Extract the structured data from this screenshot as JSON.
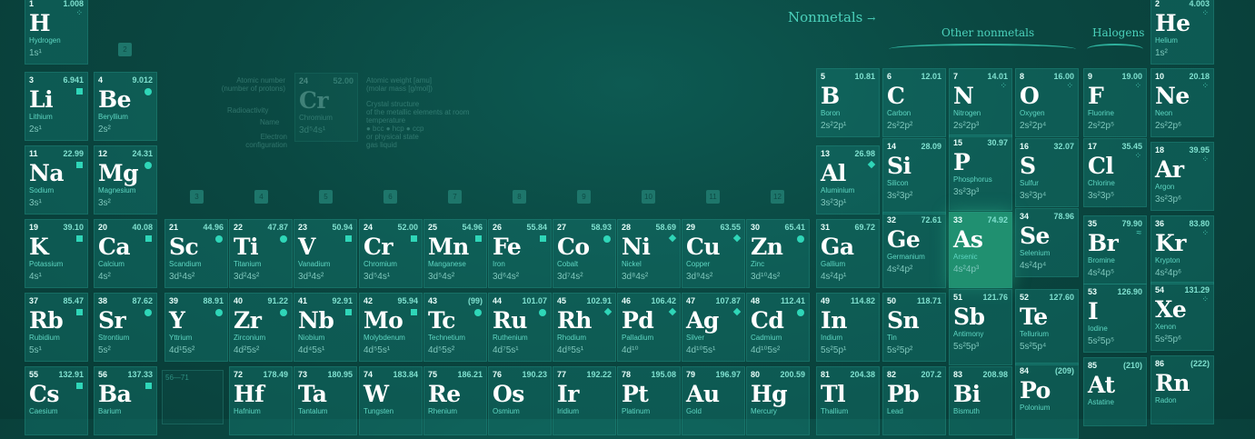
{
  "category_labels": {
    "nonmetals": "Nonmetals",
    "other_nonmetals": "Other nonmetals",
    "halogens": "Halogens"
  },
  "group_numbers": [
    "2",
    "3",
    "4",
    "5",
    "6",
    "7",
    "8",
    "9",
    "10",
    "11",
    "12"
  ],
  "legend": {
    "atomic_number": "Atomic number",
    "atomic_number_sub": "(number of protons)",
    "atomic_weight": "Atomic weight [amu]",
    "atomic_weight_sub": "(molar mass [g/mol])",
    "radioactivity": "Radioactivity",
    "name": "Name",
    "electron_configuration": "Electron configuration",
    "crystal_structure": "Crystal structure",
    "crystal_structure_sub": "of the metallic elements at room temperature",
    "crystal_types": "● bcc  ● hcp  ● ccp",
    "physical_state": "or physical state",
    "physical_types": "gas  liquid",
    "sample_num": "24",
    "sample_wt": "52.00",
    "sample_sym": "Cr",
    "sample_name": "Chromium",
    "sample_cfg": "3d⁵4s¹"
  },
  "lanthanides_range": "56—71",
  "elements": [
    {
      "num": "1",
      "wt": "1.008",
      "sym": "H",
      "name": "Hydrogen",
      "cfg": "1s¹",
      "ic": "gas"
    },
    {
      "num": "2",
      "wt": "4.003",
      "sym": "He",
      "name": "Helium",
      "cfg": "1s²",
      "ic": "gas"
    },
    {
      "num": "3",
      "wt": "6.941",
      "sym": "Li",
      "name": "Lithium",
      "cfg": "2s¹",
      "ic": "sq"
    },
    {
      "num": "4",
      "wt": "9.012",
      "sym": "Be",
      "name": "Beryllium",
      "cfg": "2s²",
      "ic": "circle"
    },
    {
      "num": "5",
      "wt": "10.81",
      "sym": "B",
      "name": "Boron",
      "cfg": "2s²2p¹",
      "ic": ""
    },
    {
      "num": "6",
      "wt": "12.01",
      "sym": "C",
      "name": "Carbon",
      "cfg": "2s²2p²",
      "ic": ""
    },
    {
      "num": "7",
      "wt": "14.01",
      "sym": "N",
      "name": "Nitrogen",
      "cfg": "2s²2p³",
      "ic": "gas"
    },
    {
      "num": "8",
      "wt": "16.00",
      "sym": "O",
      "name": "Oxygen",
      "cfg": "2s²2p⁴",
      "ic": "gas"
    },
    {
      "num": "9",
      "wt": "19.00",
      "sym": "F",
      "name": "Fluorine",
      "cfg": "2s²2p⁵",
      "ic": "gas"
    },
    {
      "num": "10",
      "wt": "20.18",
      "sym": "Ne",
      "name": "Neon",
      "cfg": "2s²2p⁶",
      "ic": "gas"
    },
    {
      "num": "11",
      "wt": "22.99",
      "sym": "Na",
      "name": "Sodium",
      "cfg": "3s¹",
      "ic": "sq"
    },
    {
      "num": "12",
      "wt": "24.31",
      "sym": "Mg",
      "name": "Magnesium",
      "cfg": "3s²",
      "ic": "circle"
    },
    {
      "num": "13",
      "wt": "26.98",
      "sym": "Al",
      "name": "Aluminium",
      "cfg": "3s²3p¹",
      "ic": "diamond"
    },
    {
      "num": "14",
      "wt": "28.09",
      "sym": "Si",
      "name": "Silicon",
      "cfg": "3s²3p²",
      "ic": ""
    },
    {
      "num": "15",
      "wt": "30.97",
      "sym": "P",
      "name": "Phosphorus",
      "cfg": "3s²3p³",
      "ic": ""
    },
    {
      "num": "16",
      "wt": "32.07",
      "sym": "S",
      "name": "Sulfur",
      "cfg": "3s²3p⁴",
      "ic": ""
    },
    {
      "num": "17",
      "wt": "35.45",
      "sym": "Cl",
      "name": "Chlorine",
      "cfg": "3s²3p⁵",
      "ic": "gas"
    },
    {
      "num": "18",
      "wt": "39.95",
      "sym": "Ar",
      "name": "Argon",
      "cfg": "3s²3p⁶",
      "ic": "gas"
    },
    {
      "num": "19",
      "wt": "39.10",
      "sym": "K",
      "name": "Potassium",
      "cfg": "4s¹",
      "ic": "sq"
    },
    {
      "num": "20",
      "wt": "40.08",
      "sym": "Ca",
      "name": "Calcium",
      "cfg": "4s²",
      "ic": "sq"
    },
    {
      "num": "21",
      "wt": "44.96",
      "sym": "Sc",
      "name": "Scandium",
      "cfg": "3d¹4s²",
      "ic": "circle"
    },
    {
      "num": "22",
      "wt": "47.87",
      "sym": "Ti",
      "name": "Titanium",
      "cfg": "3d²4s²",
      "ic": "circle"
    },
    {
      "num": "23",
      "wt": "50.94",
      "sym": "V",
      "name": "Vanadium",
      "cfg": "3d³4s²",
      "ic": "sq"
    },
    {
      "num": "24",
      "wt": "52.00",
      "sym": "Cr",
      "name": "Chromium",
      "cfg": "3d⁵4s¹",
      "ic": "sq"
    },
    {
      "num": "25",
      "wt": "54.96",
      "sym": "Mn",
      "name": "Manganese",
      "cfg": "3d⁵4s²",
      "ic": "sq"
    },
    {
      "num": "26",
      "wt": "55.84",
      "sym": "Fe",
      "name": "Iron",
      "cfg": "3d⁶4s²",
      "ic": "sq"
    },
    {
      "num": "27",
      "wt": "58.93",
      "sym": "Co",
      "name": "Cobalt",
      "cfg": "3d⁷4s²",
      "ic": "circle"
    },
    {
      "num": "28",
      "wt": "58.69",
      "sym": "Ni",
      "name": "Nickel",
      "cfg": "3d⁸4s²",
      "ic": "diamond"
    },
    {
      "num": "29",
      "wt": "63.55",
      "sym": "Cu",
      "name": "Copper",
      "cfg": "3d⁹4s²",
      "ic": "diamond"
    },
    {
      "num": "30",
      "wt": "65.41",
      "sym": "Zn",
      "name": "Zinc",
      "cfg": "3d¹⁰4s²",
      "ic": "circle"
    },
    {
      "num": "31",
      "wt": "69.72",
      "sym": "Ga",
      "name": "Gallium",
      "cfg": "4s²4p¹",
      "ic": ""
    },
    {
      "num": "32",
      "wt": "72.61",
      "sym": "Ge",
      "name": "Germanium",
      "cfg": "4s²4p²",
      "ic": ""
    },
    {
      "num": "33",
      "wt": "74.92",
      "sym": "As",
      "name": "Arsenic",
      "cfg": "4s²4p³",
      "ic": ""
    },
    {
      "num": "34",
      "wt": "78.96",
      "sym": "Se",
      "name": "Selenium",
      "cfg": "4s²4p⁴",
      "ic": ""
    },
    {
      "num": "35",
      "wt": "79.90",
      "sym": "Br",
      "name": "Bromine",
      "cfg": "4s²4p⁵",
      "ic": "liquid"
    },
    {
      "num": "36",
      "wt": "83.80",
      "sym": "Kr",
      "name": "Krypton",
      "cfg": "4s²4p⁶",
      "ic": "gas"
    },
    {
      "num": "37",
      "wt": "85.47",
      "sym": "Rb",
      "name": "Rubidium",
      "cfg": "5s¹",
      "ic": "sq"
    },
    {
      "num": "38",
      "wt": "87.62",
      "sym": "Sr",
      "name": "Strontium",
      "cfg": "5s²",
      "ic": "circle"
    },
    {
      "num": "39",
      "wt": "88.91",
      "sym": "Y",
      "name": "Yttrium",
      "cfg": "4d¹5s²",
      "ic": "circle"
    },
    {
      "num": "40",
      "wt": "91.22",
      "sym": "Zr",
      "name": "Zirconium",
      "cfg": "4d²5s²",
      "ic": "circle"
    },
    {
      "num": "41",
      "wt": "92.91",
      "sym": "Nb",
      "name": "Niobium",
      "cfg": "4d⁴5s¹",
      "ic": "sq"
    },
    {
      "num": "42",
      "wt": "95.94",
      "sym": "Mo",
      "name": "Molybdenum",
      "cfg": "4d⁵5s¹",
      "ic": "sq"
    },
    {
      "num": "43",
      "wt": "(99)",
      "sym": "Tc",
      "name": "Technetium",
      "cfg": "4d⁵5s²",
      "ic": "circle"
    },
    {
      "num": "44",
      "wt": "101.07",
      "sym": "Ru",
      "name": "Ruthenium",
      "cfg": "4d⁷5s¹",
      "ic": "circle"
    },
    {
      "num": "45",
      "wt": "102.91",
      "sym": "Rh",
      "name": "Rhodium",
      "cfg": "4d⁸5s¹",
      "ic": "diamond"
    },
    {
      "num": "46",
      "wt": "106.42",
      "sym": "Pd",
      "name": "Palladium",
      "cfg": "4d¹⁰",
      "ic": "diamond"
    },
    {
      "num": "47",
      "wt": "107.87",
      "sym": "Ag",
      "name": "Silver",
      "cfg": "4d¹⁰5s¹",
      "ic": "diamond"
    },
    {
      "num": "48",
      "wt": "112.41",
      "sym": "Cd",
      "name": "Cadmium",
      "cfg": "4d¹⁰5s²",
      "ic": "circle"
    },
    {
      "num": "49",
      "wt": "114.82",
      "sym": "In",
      "name": "Indium",
      "cfg": "5s²5p¹",
      "ic": ""
    },
    {
      "num": "50",
      "wt": "118.71",
      "sym": "Sn",
      "name": "Tin",
      "cfg": "5s²5p²",
      "ic": ""
    },
    {
      "num": "51",
      "wt": "121.76",
      "sym": "Sb",
      "name": "Antimony",
      "cfg": "5s²5p³",
      "ic": ""
    },
    {
      "num": "52",
      "wt": "127.60",
      "sym": "Te",
      "name": "Tellurium",
      "cfg": "5s²5p⁴",
      "ic": ""
    },
    {
      "num": "53",
      "wt": "126.90",
      "sym": "I",
      "name": "Iodine",
      "cfg": "5s²5p⁵",
      "ic": ""
    },
    {
      "num": "54",
      "wt": "131.29",
      "sym": "Xe",
      "name": "Xenon",
      "cfg": "5s²5p⁶",
      "ic": "gas"
    },
    {
      "num": "55",
      "wt": "132.91",
      "sym": "Cs",
      "name": "Caesium",
      "cfg": "",
      "ic": "sq"
    },
    {
      "num": "56",
      "wt": "137.33",
      "sym": "Ba",
      "name": "Barium",
      "cfg": "",
      "ic": "sq"
    },
    {
      "num": "72",
      "wt": "178.49",
      "sym": "Hf",
      "name": "Hafnium",
      "cfg": "",
      "ic": ""
    },
    {
      "num": "73",
      "wt": "180.95",
      "sym": "Ta",
      "name": "Tantalum",
      "cfg": "",
      "ic": ""
    },
    {
      "num": "74",
      "wt": "183.84",
      "sym": "W",
      "name": "Tungsten",
      "cfg": "",
      "ic": ""
    },
    {
      "num": "75",
      "wt": "186.21",
      "sym": "Re",
      "name": "Rhenium",
      "cfg": "",
      "ic": ""
    },
    {
      "num": "76",
      "wt": "190.23",
      "sym": "Os",
      "name": "Osmium",
      "cfg": "",
      "ic": ""
    },
    {
      "num": "77",
      "wt": "192.22",
      "sym": "Ir",
      "name": "Iridium",
      "cfg": "",
      "ic": ""
    },
    {
      "num": "78",
      "wt": "195.08",
      "sym": "Pt",
      "name": "Platinum",
      "cfg": "",
      "ic": ""
    },
    {
      "num": "79",
      "wt": "196.97",
      "sym": "Au",
      "name": "Gold",
      "cfg": "",
      "ic": ""
    },
    {
      "num": "80",
      "wt": "200.59",
      "sym": "Hg",
      "name": "Mercury",
      "cfg": "",
      "ic": ""
    },
    {
      "num": "81",
      "wt": "204.38",
      "sym": "Tl",
      "name": "Thallium",
      "cfg": "",
      "ic": ""
    },
    {
      "num": "82",
      "wt": "207.2",
      "sym": "Pb",
      "name": "Lead",
      "cfg": "",
      "ic": ""
    },
    {
      "num": "83",
      "wt": "208.98",
      "sym": "Bi",
      "name": "Bismuth",
      "cfg": "",
      "ic": ""
    },
    {
      "num": "84",
      "wt": "(209)",
      "sym": "Po",
      "name": "Polonium",
      "cfg": "",
      "ic": ""
    },
    {
      "num": "85",
      "wt": "(210)",
      "sym": "At",
      "name": "Astatine",
      "cfg": "",
      "ic": ""
    },
    {
      "num": "86",
      "wt": "(222)",
      "sym": "Rn",
      "name": "Radon",
      "cfg": "",
      "ic": ""
    }
  ]
}
